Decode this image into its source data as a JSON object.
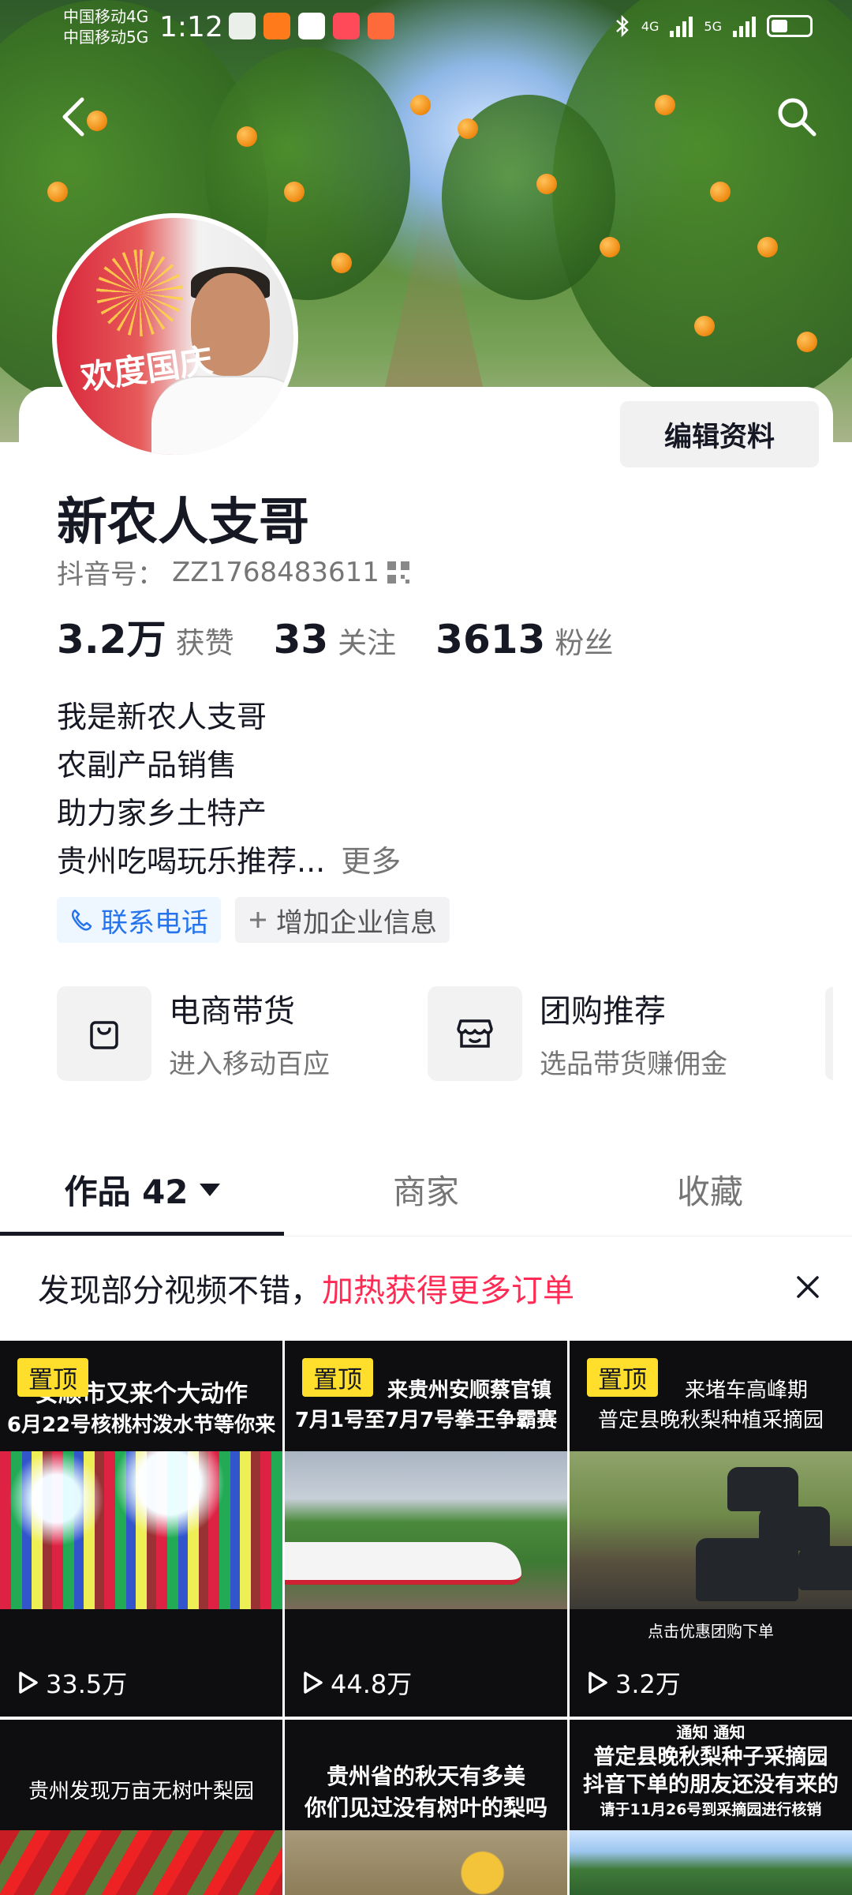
{
  "status_bar": {
    "carrier_1": "中国移动4G",
    "carrier_2": "中国移动5G",
    "time": "1:12",
    "network_1": "4G",
    "network_2": "5G"
  },
  "profile": {
    "edit_label": "编辑资料",
    "name": "新农人支哥",
    "id_label": "抖音号：",
    "id_value": "ZZ1768483611",
    "avatar_text": "欢度国庆",
    "stats": [
      {
        "num": "3.2万",
        "label": "获赞"
      },
      {
        "num": "33",
        "label": "关注"
      },
      {
        "num": "3613",
        "label": "粉丝"
      }
    ],
    "bio": [
      "我是新农人支哥",
      "农副产品销售",
      "助力家乡土特产",
      "贵州吃喝玩乐推荐..."
    ],
    "bio_more": "更多",
    "tags": {
      "phone": "联系电话",
      "company": "增加企业信息"
    },
    "services": [
      {
        "title": "电商带货",
        "subtitle": "进入移动百应",
        "icon": "shopping-bag-icon"
      },
      {
        "title": "团购推荐",
        "subtitle": "选品带货赚佣金",
        "icon": "store-icon"
      }
    ]
  },
  "tabs": [
    {
      "label": "作品 42",
      "active": true
    },
    {
      "label": "商家",
      "active": false
    },
    {
      "label": "收藏",
      "active": false
    }
  ],
  "promo": {
    "text": "发现部分视频不错，",
    "highlight": "加热获得更多订单"
  },
  "videos": [
    {
      "pinned": "置顶",
      "caption_1": "安顺市又来个大动作",
      "caption_2": "6月22号核桃村泼水节等你来",
      "views": "33.5万"
    },
    {
      "pinned": "置顶",
      "caption_1": "来贵州安顺蔡官镇",
      "caption_2": "7月1号至7月7号拳王争霸赛",
      "views": "44.8万"
    },
    {
      "pinned": "置顶",
      "caption_1": "来堵车高峰期",
      "caption_2": "普定县晚秋梨种植采摘园",
      "sub": "点击优惠团购下单",
      "views": "3.2万"
    },
    {
      "caption_1": "贵州发现万亩无树叶梨园"
    },
    {
      "caption_1": "贵州省的秋天有多美",
      "caption_2": "你们见过没有树叶的梨吗"
    },
    {
      "caption_0": "通知        通知",
      "caption_1": "普定县晚秋梨种子采摘园",
      "caption_2": "抖音下单的朋友还没有来的",
      "caption_3": "请于11月26号到采摘园进行核销"
    }
  ],
  "colors": {
    "accent": "#fe2c55",
    "link": "#2574ed",
    "pin": "#ffdf2b"
  }
}
